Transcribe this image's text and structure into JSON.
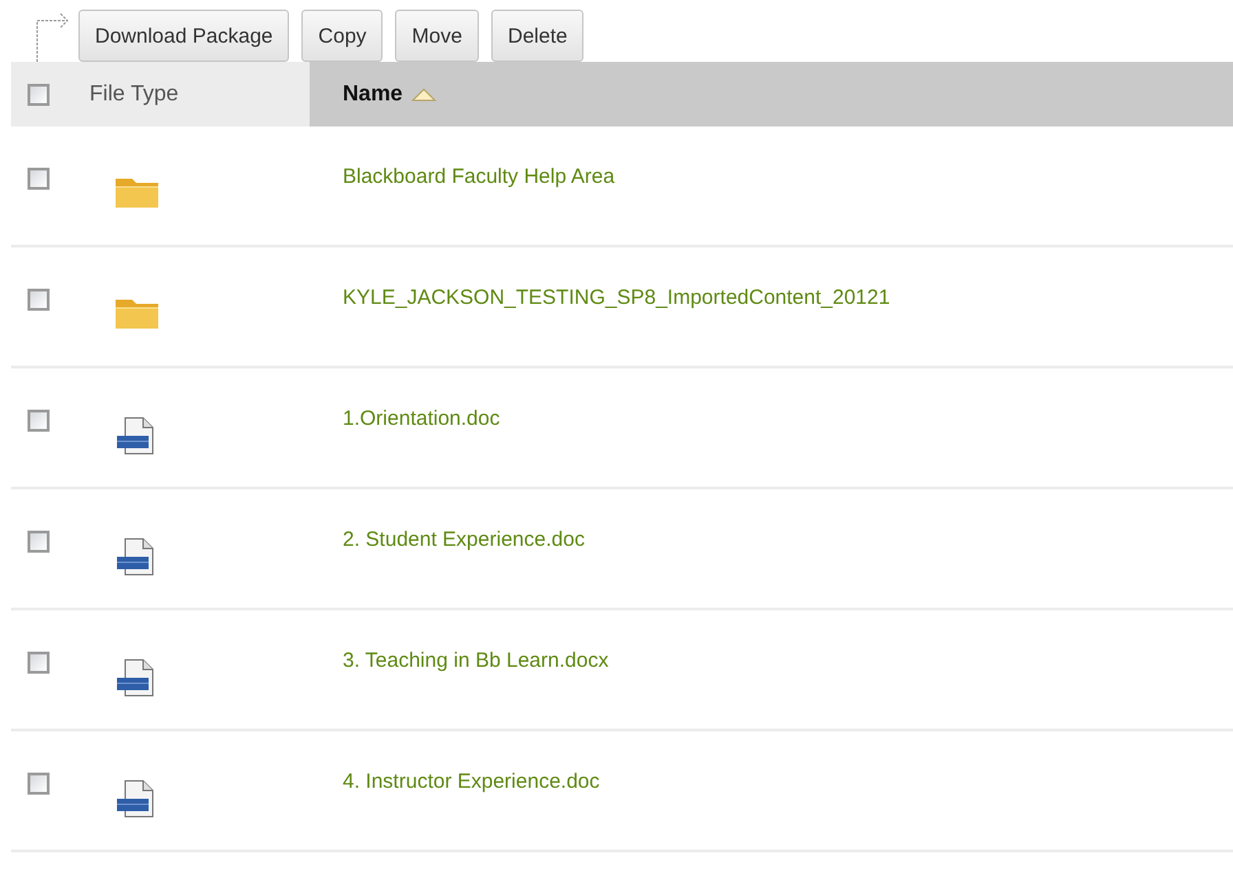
{
  "toolbar": {
    "buttons": [
      "Download Package",
      "Copy",
      "Move",
      "Delete"
    ]
  },
  "table": {
    "select_all": {
      "checked": false
    },
    "columns": [
      {
        "label": "File Type",
        "sorted": false
      },
      {
        "label": "Name",
        "sorted": true
      }
    ],
    "rows": [
      {
        "checked": false,
        "kind": "folder",
        "name": "Blackboard Faculty Help Area"
      },
      {
        "checked": false,
        "kind": "folder",
        "name": "KYLE_JACKSON_TESTING_SP8_ImportedContent_20121"
      },
      {
        "checked": false,
        "kind": "doc",
        "name": "1.Orientation.doc"
      },
      {
        "checked": false,
        "kind": "doc",
        "name": "2. Student Experience.doc"
      },
      {
        "checked": false,
        "kind": "doc",
        "name": "3. Teaching in Bb Learn.docx"
      },
      {
        "checked": false,
        "kind": "doc",
        "name": "4. Instructor Experience.doc"
      }
    ]
  }
}
